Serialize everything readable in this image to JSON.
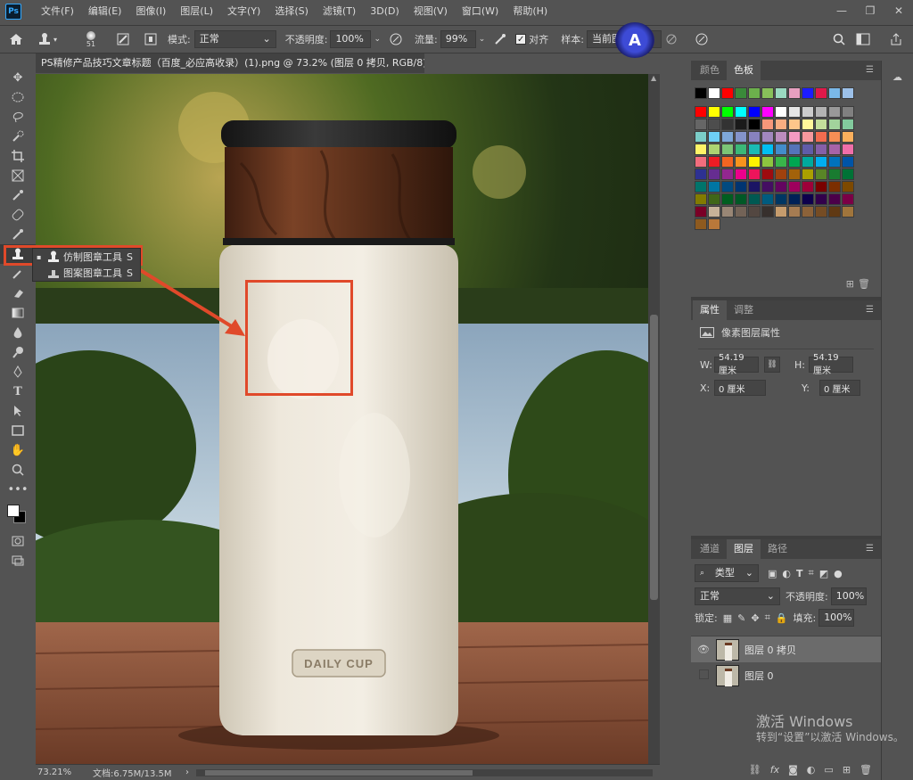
{
  "app": {
    "logo": "Ps"
  },
  "menu": [
    "文件(F)",
    "编辑(E)",
    "图像(I)",
    "图层(L)",
    "文字(Y)",
    "选择(S)",
    "滤镜(T)",
    "3D(D)",
    "视图(V)",
    "窗口(W)",
    "帮助(H)"
  ],
  "window_controls": {
    "minimize": "—",
    "restore": "❐",
    "close": "✕"
  },
  "options": {
    "brush_size": "51",
    "mode_label": "模式:",
    "mode_value": "正常",
    "opacity_label": "不透明度:",
    "opacity_value": "100%",
    "flow_label": "流量:",
    "flow_value": "99%",
    "align_label": "对齐",
    "sample_label": "样本:",
    "sample_value": "当前图层"
  },
  "document": {
    "tab_title": "PS精修产品技巧文章标题（百度_必应高收录）(1).png @ 73.2% (图层 0 拷贝, RGB/8) *",
    "product_label": "DAILY CUP"
  },
  "tool_flyout": {
    "item1": "仿制图章工具",
    "item1_key": "S",
    "item2": "图案图章工具",
    "item2_key": "S"
  },
  "status": {
    "zoom": "73.21%",
    "doc_size": "文档:6.75M/13.5M"
  },
  "color_panel": {
    "tab1": "颜色",
    "tab2": "色板"
  },
  "properties_panel": {
    "tab1": "属性",
    "tab2": "调整",
    "header": "像素图层属性",
    "w_label": "W:",
    "w_value": "54.19 厘米",
    "h_label": "H:",
    "h_value": "54.19 厘米",
    "x_label": "X:",
    "x_value": "0 厘米",
    "y_label": "Y:",
    "y_value": "0 厘米"
  },
  "layers_panel": {
    "tab1": "通道",
    "tab2": "图层",
    "tab3": "路径",
    "filter_label": "类型",
    "blend_mode": "正常",
    "opacity_label": "不透明度:",
    "opacity_value": "100%",
    "lock_label": "锁定:",
    "fill_label": "填充:",
    "fill_value": "100%",
    "layers": [
      {
        "name": "图层 0 拷贝",
        "visible": true,
        "selected": true
      },
      {
        "name": "图层 0",
        "visible": false,
        "selected": false
      }
    ]
  },
  "os_watermark": {
    "line1": "激活 Windows",
    "line2": "转到“设置”以激活 Windows。"
  },
  "colors": {
    "accent": "#e0492a",
    "panel": "#535353",
    "dark": "#424242"
  }
}
